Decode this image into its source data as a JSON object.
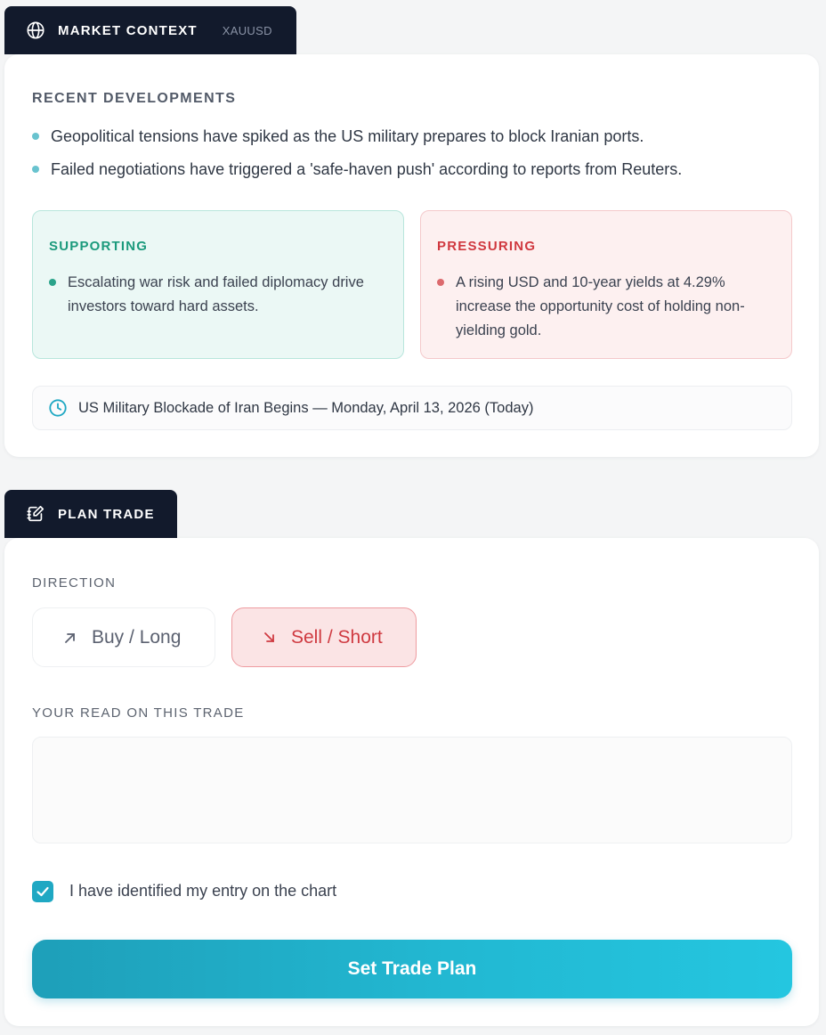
{
  "market_context": {
    "tab_title": "MARKET CONTEXT",
    "symbol": "XAUUSD",
    "recent_label": "RECENT DEVELOPMENTS",
    "developments": [
      "Geopolitical tensions have spiked as the US military prepares to block Iranian ports.",
      "Failed negotiations have triggered a 'safe-haven push' according to reports from Reuters."
    ],
    "supporting": {
      "title": "SUPPORTING",
      "text": "Escalating war risk and failed diplomacy drive investors toward hard assets."
    },
    "pressuring": {
      "title": "PRESSURING",
      "text": "A rising USD and 10-year yields at 4.29% increase the opportunity cost of holding non-yielding gold."
    },
    "event": "US Military Blockade of Iran Begins — Monday, April 13, 2026 (Today)"
  },
  "plan_trade": {
    "tab_title": "PLAN TRADE",
    "direction_label": "DIRECTION",
    "buy_label": "Buy / Long",
    "sell_label": "Sell / Short",
    "selected_direction": "Sell / Short",
    "read_label": "YOUR READ ON THIS TRADE",
    "read_value": "",
    "checkbox_label": "I have identified my entry on the chart",
    "checkbox_checked": true,
    "submit_label": "Set Trade Plan"
  },
  "colors": {
    "tab_bg": "#121a2c",
    "accent": "#22b8d2",
    "supporting": "#1b9a7c",
    "pressuring": "#d0383f"
  },
  "icons": {
    "market_context": "globe-icon",
    "plan_trade": "notebook-edit-icon",
    "event": "clock-icon",
    "buy": "arrow-up-right-icon",
    "sell": "arrow-down-right-icon",
    "checkbox": "check-icon"
  }
}
